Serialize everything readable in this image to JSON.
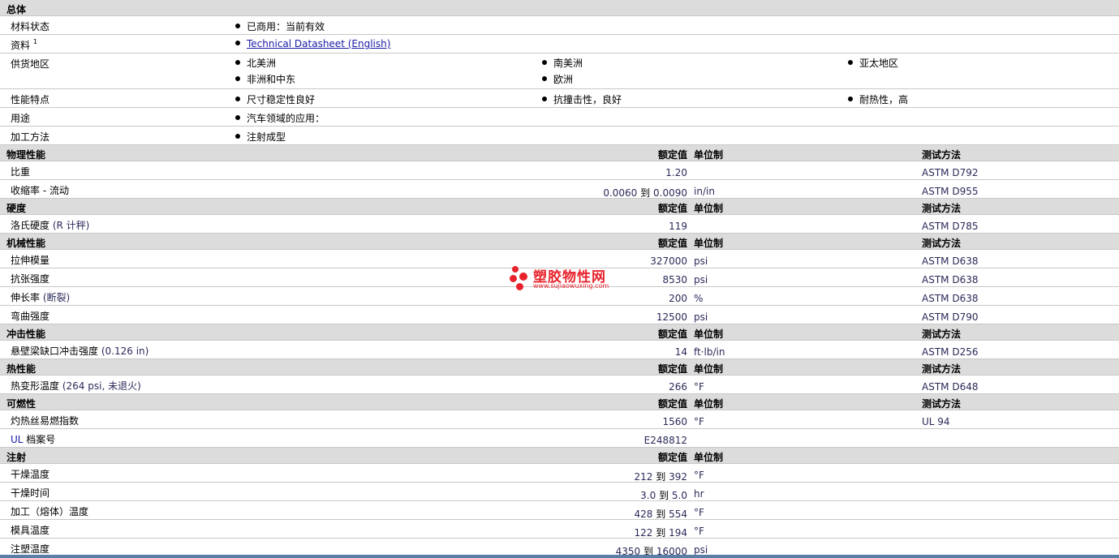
{
  "general": {
    "title": "总体",
    "rows": [
      {
        "label": "材料状态",
        "items": [
          "已商用：当前有效"
        ]
      },
      {
        "label": "资料",
        "sup": "1",
        "link": "Technical Datasheet (English)"
      },
      {
        "label": "供货地区",
        "items": [
          "北美洲",
          "南美洲",
          "亚太地区",
          "非洲和中东",
          "欧洲"
        ]
      },
      {
        "label": "性能特点",
        "items": [
          "尺寸稳定性良好",
          "抗撞击性，良好",
          "耐热性，高"
        ]
      },
      {
        "label": "用途",
        "items": [
          "汽车领域的应用："
        ]
      },
      {
        "label": "加工方法",
        "items": [
          "注射成型"
        ]
      }
    ]
  },
  "headers": {
    "nominal": "额定值",
    "unit": "单位制",
    "test": "测试方法"
  },
  "to_word": "到",
  "physical": {
    "title": "物理性能",
    "rows": [
      {
        "label": "比重",
        "value": "1.20",
        "unit": "",
        "test": "ASTM D792"
      },
      {
        "label": "收缩率 - 流动",
        "low": "0.0060",
        "high": "0.0090",
        "unit": "in/in",
        "test": "ASTM D955"
      }
    ]
  },
  "hardness": {
    "title": "硬度",
    "rows": [
      {
        "label": "洛氏硬度",
        "cond": "(R 计秤)",
        "value": "119",
        "unit": "",
        "test": "ASTM D785"
      }
    ]
  },
  "mechanical": {
    "title": "机械性能",
    "rows": [
      {
        "label": "拉伸模量",
        "value": "327000",
        "unit": "psi",
        "test": "ASTM D638"
      },
      {
        "label": "抗张强度",
        "value": "8530",
        "unit": "psi",
        "test": "ASTM D638"
      },
      {
        "label": "伸长率",
        "cond": "(断裂)",
        "value": "200",
        "unit": "%",
        "test": "ASTM D638"
      },
      {
        "label": "弯曲强度",
        "value": "12500",
        "unit": "psi",
        "test": "ASTM D790"
      }
    ]
  },
  "impact": {
    "title": "冲击性能",
    "rows": [
      {
        "label": "悬壁梁缺口冲击强度",
        "cond": "(0.126 in)",
        "value": "14",
        "unit": "ft·lb/in",
        "test": "ASTM D256"
      }
    ]
  },
  "thermal": {
    "title": "热性能",
    "rows": [
      {
        "label": "热变形温度",
        "cond": "(264 psi, 未退火)",
        "value": "266",
        "unit": "°F",
        "test": "ASTM D648"
      }
    ]
  },
  "flammability": {
    "title": "可燃性",
    "rows": [
      {
        "label": "灼热丝易燃指数",
        "value": "1560",
        "unit": "°F",
        "test": "UL 94"
      },
      {
        "label_prefix": "UL",
        "label": "档案号",
        "value": "E248812",
        "unit": "",
        "test": ""
      }
    ]
  },
  "injection": {
    "title": "注射",
    "rows": [
      {
        "label": "干燥温度",
        "low": "212",
        "high": "392",
        "unit": "°F"
      },
      {
        "label": "干燥时间",
        "low": "3.0",
        "high": "5.0",
        "unit": "hr"
      },
      {
        "label": "加工（熔体）温度",
        "low": "428",
        "high": "554",
        "unit": "°F"
      },
      {
        "label": "模具温度",
        "low": "122",
        "high": "194",
        "unit": "°F"
      },
      {
        "label": "注塑温度",
        "low": "4350",
        "high": "16000",
        "unit": "psi"
      }
    ]
  },
  "watermark": {
    "name": "塑胶物性网",
    "url": "www.sujiaowuxing.com",
    "color": "#e8222b"
  }
}
